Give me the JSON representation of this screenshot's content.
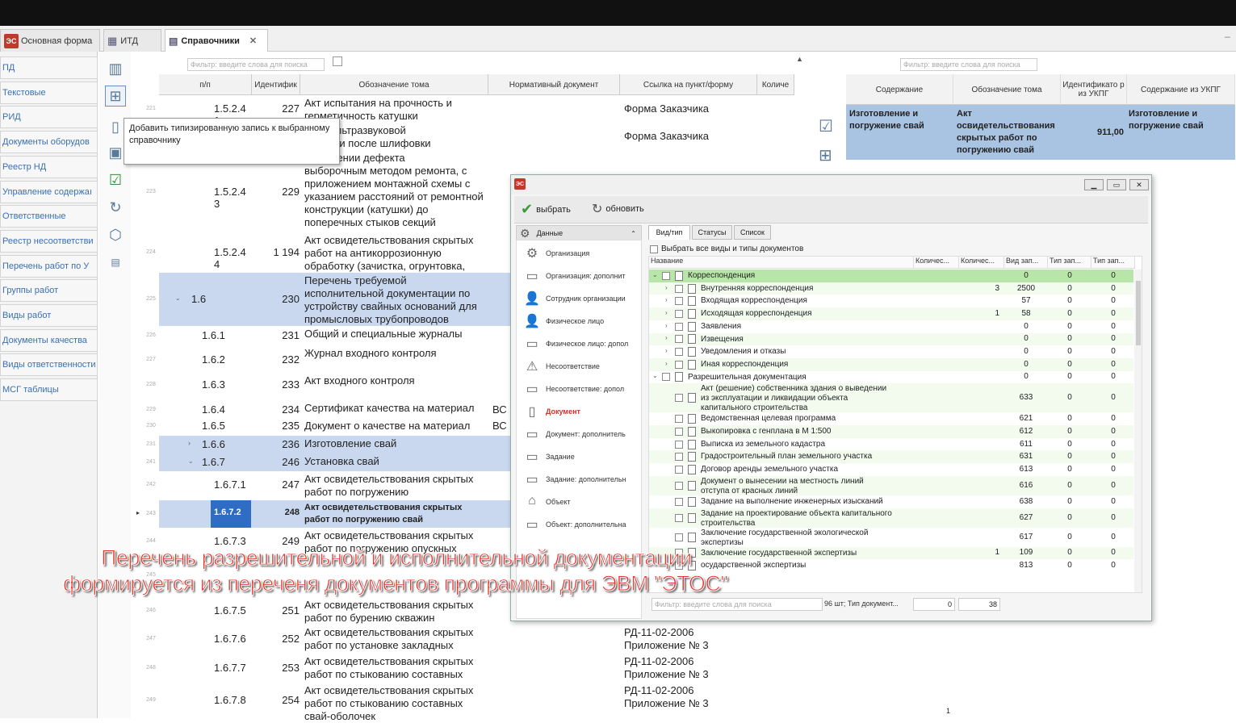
{
  "tabs": [
    {
      "label": "Основная форма"
    },
    {
      "label": "ИТД"
    },
    {
      "label": "Справочники"
    }
  ],
  "sidebar": [
    "ПД",
    "Текстовые",
    "РИД",
    "Документы оборудов",
    "Реестр НД",
    "Управление содержаı",
    "Ответственные",
    "Реестр несоответстви",
    "Перечень работ по У",
    "Группы работ",
    "Виды работ",
    "Документы качества",
    "Виды ответственности",
    "МСГ таблицы"
  ],
  "filter_placeholder": "Фильтр: введите слова для поиска",
  "tooltip": "Добавить типизированную запись к выбранному справочнику",
  "columns": [
    "п/п",
    "Идентифик",
    "Обозначение тома",
    "Нормативный документ",
    "Ссылка на пункт/форму",
    "Количе"
  ],
  "rows": [
    {
      "rn": "221",
      "pp": "1.5.2.4\n1",
      "id": "227",
      "name": "Акт испытания на прочность и\nгерметичность катушки",
      "link": "Форма Заказчика"
    },
    {
      "rn": "222",
      "pp": "",
      "id": "",
      "name": "ение ультразвуковой\nометрии после шлифовки",
      "link": "Форма Заказчика"
    },
    {
      "rn": "223",
      "pp": "1.5.2.4\n3",
      "id": "229",
      "name": "устранении дефекта\nвыборочным методом ремонта, с\nприложением монтажной схемы с\nуказанием расстояний от ремонтной\nконструкции (катушки) до\nпоперечных стыков секций",
      "link": ""
    },
    {
      "rn": "224",
      "pp": "1.5.2.4\n4",
      "id": "1 194",
      "name": "Акт освидетельствования скрытых\nработ на антикоррозионную\nобработку (зачистка, огрунтовка,",
      "link": ""
    },
    {
      "rn": "225",
      "pp": "1.6",
      "id": "230",
      "name": "Перечень требуемой\nисполнительной документации по\nустройству свайных оснований для\nпромысловых трубопроводов",
      "link": ""
    },
    {
      "rn": "226",
      "pp": "1.6.1",
      "id": "231",
      "name": "Общий и специальные журналы",
      "link": ""
    },
    {
      "rn": "227",
      "pp": "1.6.2",
      "id": "232",
      "name": "Журнал входного контроля",
      "link": ""
    },
    {
      "rn": "228",
      "pp": "1.6.3",
      "id": "233",
      "name": "Акт входного контроля",
      "link": ""
    },
    {
      "rn": "229",
      "pp": "1.6.4",
      "id": "234",
      "name": "Сертификат  качества на материал",
      "nd": "ВС",
      "link": ""
    },
    {
      "rn": "230",
      "pp": "1.6.5",
      "id": "235",
      "name": "Документ о качестве на материал",
      "nd": "ВС",
      "link": ""
    },
    {
      "rn": "231",
      "pp": "1.6.6",
      "id": "236",
      "name": "Изготовление свай",
      "link": ""
    },
    {
      "rn": "241",
      "pp": "1.6.7",
      "id": "246",
      "name": "Установка свай",
      "link": ""
    },
    {
      "rn": "242",
      "pp": "1.6.7.1",
      "id": "247",
      "name": "Акт освидетельствования скрытых\nработ по погружению",
      "link": ""
    },
    {
      "rn": "243",
      "pp": "1.6.7.2",
      "id": "248",
      "name": "Акт освидетельствования скрытых\nработ по погружению свай",
      "link": ""
    },
    {
      "rn": "244",
      "pp": "1.6.7.3",
      "id": "249",
      "name": "Акт освидетельствования скрытых\nработ по погружению опускных",
      "link": ""
    },
    {
      "rn": "245",
      "pp": "",
      "id": "",
      "name": "",
      "link": ""
    },
    {
      "rn": "246",
      "pp": "1.6.7.5",
      "id": "251",
      "name": "Акт освидетельствования скрытых\nработ по бурению скважин",
      "link": ""
    },
    {
      "rn": "247",
      "pp": "1.6.7.6",
      "id": "252",
      "name": "Акт освидетельствования скрытых\nработ по установке закладных",
      "link": "РД-11-02-2006\nПриложение № 3"
    },
    {
      "rn": "248",
      "pp": "1.6.7.7",
      "id": "253",
      "name": "Акт освидетельствования скрытых\nработ по стыкованию составных",
      "link": "РД-11-02-2006\nПриложение № 3"
    },
    {
      "rn": "249",
      "pp": "1.6.7.8",
      "id": "254",
      "name": "Акт освидетельствования скрытых\nработ по стыкованию составных\nсвай-оболочек",
      "link": "РД-11-02-2006\nПриложение № 3"
    }
  ],
  "right_columns": [
    "Содержание",
    "Обозначение тома",
    "Идентификато р из УКПГ",
    "Содержание из УКПГ"
  ],
  "right_row": {
    "content": "Изготовление и\nпогружение свай",
    "tom": "Акт\nосвидетельствования\nскрытых работ по\nпогружению свай",
    "ident": "911,00",
    "ukpg": "Изготовление и\nпогружение свай"
  },
  "dialog": {
    "choose": "выбрать",
    "refresh": "обновить",
    "nav_header": "Данные",
    "nav": [
      "Организация",
      "Организация: дополнит",
      "Сотрудник организации",
      "Физическое лицо",
      "Физическое лицо: допол",
      "Несоответствие",
      "Несоответствие: допол",
      "Документ",
      "Документ: дополнитель",
      "Задание",
      "Задание: дополнительн",
      "Объект",
      "Объект: дополнительна"
    ],
    "tabs": [
      "Вид/тип",
      "Статусы",
      "Список"
    ],
    "select_all": "Выбрать все виды и типы документов",
    "cols": [
      "Название",
      "Количес...",
      "Количес...",
      "Вид зап...",
      "Тип зап...",
      "Тип зап..."
    ],
    "tree": [
      {
        "t": "Корреспонденция",
        "a": "",
        "b": "",
        "c": "0",
        "d": "0",
        "e": "0",
        "lvl": 0
      },
      {
        "t": "Внутренняя корреспонденция",
        "a": "",
        "b": "3",
        "c": "2500",
        "d": "0",
        "e": "0",
        "lvl": 1
      },
      {
        "t": "Входящая корреспонденция",
        "a": "",
        "b": "",
        "c": "57",
        "d": "0",
        "e": "0",
        "lvl": 1
      },
      {
        "t": "Исходящая корреспонденция",
        "a": "",
        "b": "1",
        "c": "58",
        "d": "0",
        "e": "0",
        "lvl": 1
      },
      {
        "t": "Заявления",
        "a": "",
        "b": "",
        "c": "0",
        "d": "0",
        "e": "0",
        "lvl": 1
      },
      {
        "t": "Извещения",
        "a": "",
        "b": "",
        "c": "0",
        "d": "0",
        "e": "0",
        "lvl": 1
      },
      {
        "t": "Уведомления и отказы",
        "a": "",
        "b": "",
        "c": "0",
        "d": "0",
        "e": "0",
        "lvl": 1
      },
      {
        "t": "Иная корреспонденция",
        "a": "",
        "b": "",
        "c": "0",
        "d": "0",
        "e": "0",
        "lvl": 1
      },
      {
        "t": "Разрешительная документация",
        "a": "",
        "b": "",
        "c": "0",
        "d": "0",
        "e": "0",
        "lvl": 0
      },
      {
        "t": "Акт (решение) собственника здания о выведении\nиз эксплуатации и ликвидации объекта\nкапитального строительства",
        "a": "",
        "b": "",
        "c": "633",
        "d": "0",
        "e": "0",
        "lvl": 1
      },
      {
        "t": "Ведомственная целевая программа",
        "a": "",
        "b": "",
        "c": "621",
        "d": "0",
        "e": "0",
        "lvl": 1
      },
      {
        "t": "Выкопировка с генплана в М 1:500",
        "a": "",
        "b": "",
        "c": "612",
        "d": "0",
        "e": "0",
        "lvl": 1
      },
      {
        "t": "Выписка из земельного кадастра",
        "a": "",
        "b": "",
        "c": "611",
        "d": "0",
        "e": "0",
        "lvl": 1
      },
      {
        "t": "Градостроительный план земельного участка",
        "a": "",
        "b": "",
        "c": "631",
        "d": "0",
        "e": "0",
        "lvl": 1
      },
      {
        "t": "Договор аренды земельного участка",
        "a": "",
        "b": "",
        "c": "613",
        "d": "0",
        "e": "0",
        "lvl": 1
      },
      {
        "t": "Документ  о вынесении на местность линий\nотступа от красных линий",
        "a": "",
        "b": "",
        "c": "616",
        "d": "0",
        "e": "0",
        "lvl": 1
      },
      {
        "t": "Задание на выполнение инженерных изысканий",
        "a": "",
        "b": "",
        "c": "638",
        "d": "0",
        "e": "0",
        "lvl": 1
      },
      {
        "t": "Задание на проектирование объекта капитального\nстроительства",
        "a": "",
        "b": "",
        "c": "627",
        "d": "0",
        "e": "0",
        "lvl": 1
      },
      {
        "t": "Заключение государственной экологической\nэкспертизы",
        "a": "",
        "b": "",
        "c": "617",
        "d": "0",
        "e": "0",
        "lvl": 1
      },
      {
        "t": "Заключение государственной экспертизы",
        "a": "",
        "b": "1",
        "c": "109",
        "d": "0",
        "e": "0",
        "lvl": 1
      },
      {
        "t": "осударственной экспертизы",
        "a": "",
        "b": "",
        "c": "813",
        "d": "0",
        "e": "0",
        "lvl": 1
      }
    ],
    "bottom_filter": "Фильтр: введите слова для поиска",
    "bottom_summary": "96 шт; Тип документ...",
    "bottom_a": "0",
    "bottom_b": "38"
  },
  "overlay_line1": "Перечень разрешительной и исполнительной документации",
  "overlay_line2": "формируется из переченя документов программы для ЭВМ \"ЭТОС\"",
  "page_number": "1"
}
